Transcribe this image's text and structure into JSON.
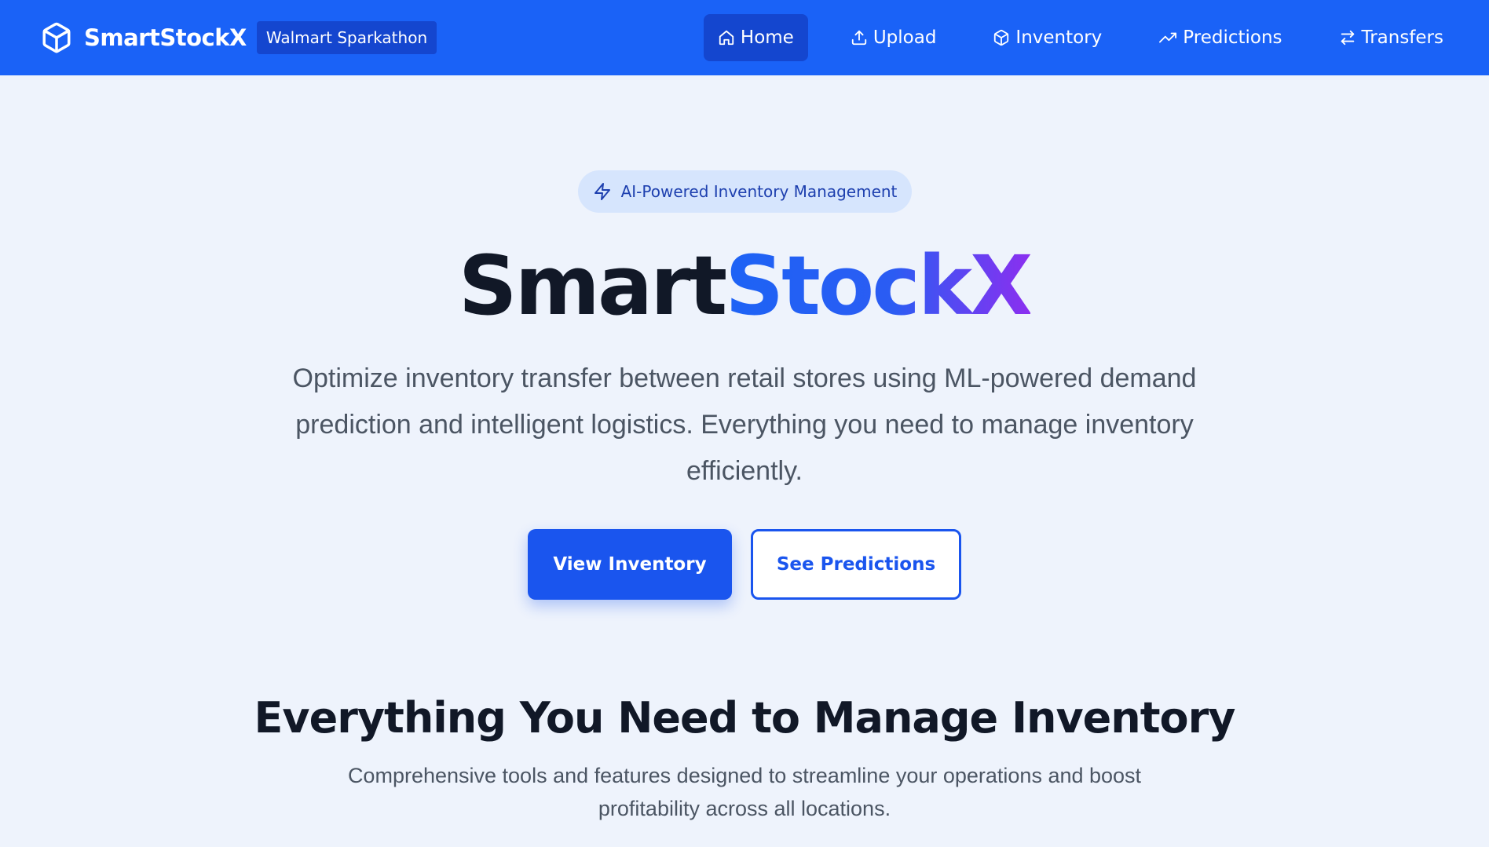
{
  "brand": {
    "name": "SmartStockX",
    "badge": "Walmart Sparkathon",
    "icon": "package-cube-icon"
  },
  "nav": {
    "items": [
      {
        "label": "Home",
        "icon": "home-icon",
        "active": true
      },
      {
        "label": "Upload",
        "icon": "upload-icon",
        "active": false
      },
      {
        "label": "Inventory",
        "icon": "package-icon",
        "active": false
      },
      {
        "label": "Predictions",
        "icon": "trending-up-icon",
        "active": false
      },
      {
        "label": "Transfers",
        "icon": "arrows-swap-icon",
        "active": false
      }
    ]
  },
  "hero": {
    "pill_label": "AI-Powered Inventory Management",
    "pill_icon": "lightning-icon",
    "title_part1": "Smart",
    "title_part2": "StockX",
    "description": "Optimize inventory transfer between retail stores using ML-powered demand prediction and intelligent logistics. Everything you need to manage inventory efficiently.",
    "primary_button": "View Inventory",
    "secondary_button": "See Predictions"
  },
  "features": {
    "title": "Everything You Need to Manage Inventory",
    "description": "Comprehensive tools and features designed to streamline your operations and boost profitability across all locations."
  },
  "colors": {
    "nav_background": "#1a62f7",
    "nav_active": "#1446cf",
    "accent": "#1a55ee",
    "gradient_end": "#8b2ff0",
    "page_background": "#eef3fc"
  }
}
